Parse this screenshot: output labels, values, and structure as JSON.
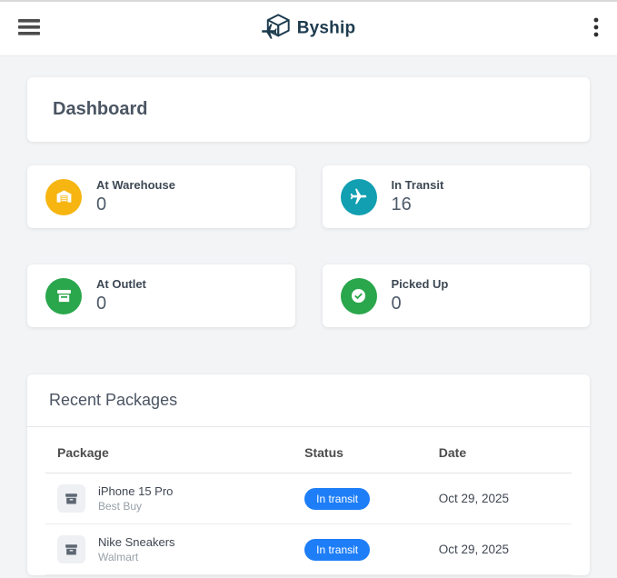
{
  "header": {
    "brand": "Byship",
    "menu_icon": "hamburger-icon",
    "more_icon": "kebab-icon",
    "brand_color": "#1d3b4e"
  },
  "page": {
    "title": "Dashboard"
  },
  "stats": [
    {
      "label": "At Warehouse",
      "value": "0",
      "icon": "warehouse-icon",
      "color": "#f7b512"
    },
    {
      "label": "In Transit",
      "value": "16",
      "icon": "plane-icon",
      "color": "#129fb1"
    },
    {
      "label": "At Outlet",
      "value": "0",
      "icon": "store-icon",
      "color": "#2aa64c"
    },
    {
      "label": "Picked Up",
      "value": "0",
      "icon": "check-circle-icon",
      "color": "#2aa64c"
    }
  ],
  "recent_packages": {
    "title": "Recent Packages",
    "columns": [
      "Package",
      "Status",
      "Date"
    ],
    "status_color": "#1e7ef7",
    "rows": [
      {
        "name": "iPhone 15 Pro",
        "merchant": "Best Buy",
        "status": "In transit",
        "date": "Oct 29, 2025"
      },
      {
        "name": "Nike Sneakers",
        "merchant": "Walmart",
        "status": "In transit",
        "date": "Oct 29, 2025"
      }
    ]
  }
}
